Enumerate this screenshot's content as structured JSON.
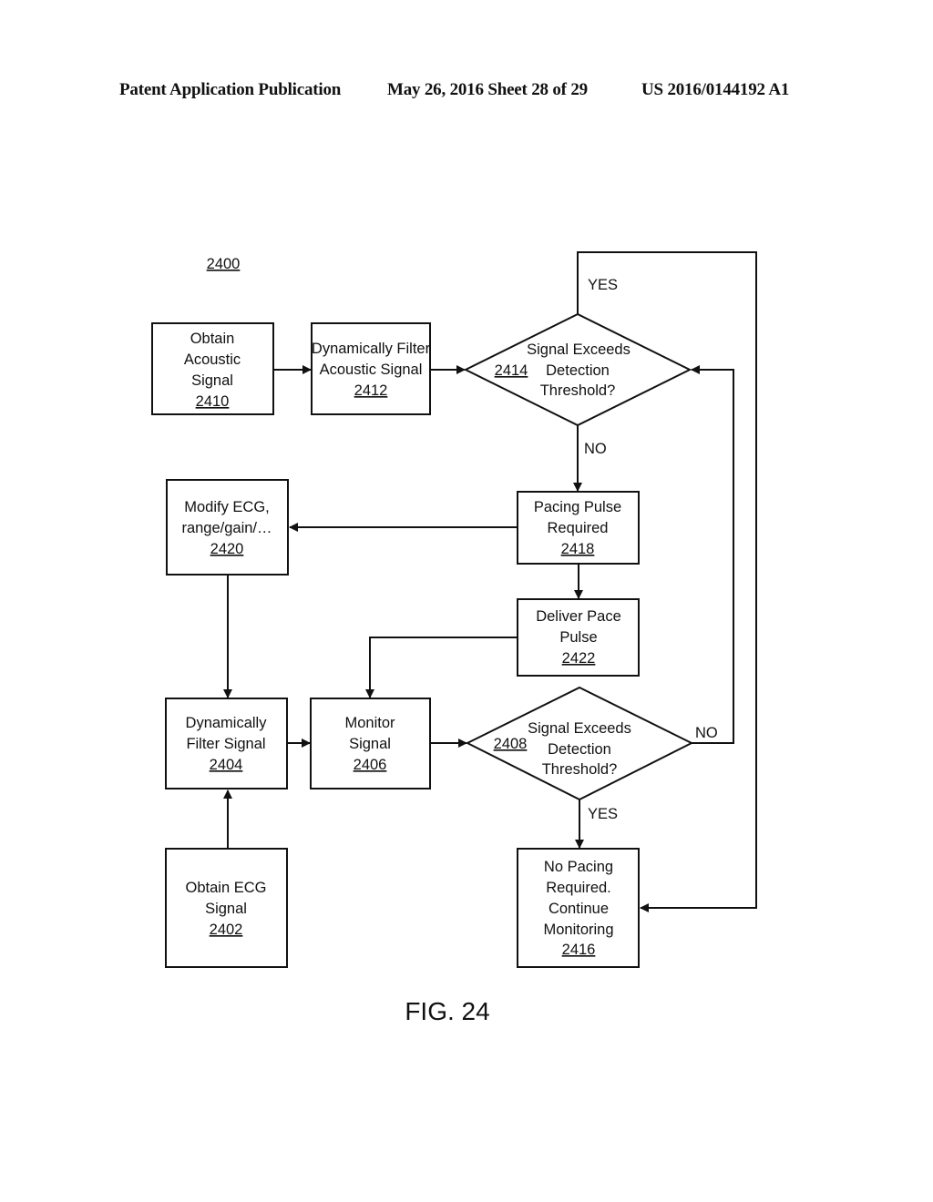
{
  "header": {
    "publication": "Patent Application Publication",
    "date_sheet": "May 26, 2016  Sheet 28 of 29",
    "number": "US 2016/0144192 A1"
  },
  "figure": {
    "ref": "2400",
    "caption": "FIG. 24",
    "nodes": {
      "n2410": {
        "lines": [
          "Obtain",
          "Acoustic",
          "Signal"
        ],
        "ref": "2410"
      },
      "n2412": {
        "lines": [
          "Dynamically Filter",
          "Acoustic Signal"
        ],
        "ref": "2412"
      },
      "n2414": {
        "lines": [
          "Signal Exceeds",
          "Detection",
          "Threshold?"
        ],
        "ref": "2414"
      },
      "n2418": {
        "lines": [
          "Pacing Pulse",
          "Required"
        ],
        "ref": "2418"
      },
      "n2420": {
        "lines": [
          "Modify ECG,",
          "range/gain/…"
        ],
        "ref": "2420"
      },
      "n2422": {
        "lines": [
          "Deliver Pace",
          "Pulse"
        ],
        "ref": "2422"
      },
      "n2404": {
        "lines": [
          "Dynamically",
          "Filter Signal"
        ],
        "ref": "2404"
      },
      "n2406": {
        "lines": [
          "Monitor",
          "Signal"
        ],
        "ref": "2406"
      },
      "n2408": {
        "lines": [
          "Signal Exceeds",
          "Detection",
          "Threshold?"
        ],
        "ref": "2408"
      },
      "n2402": {
        "lines": [
          "Obtain ECG",
          "Signal"
        ],
        "ref": "2402"
      },
      "n2416": {
        "lines": [
          "No Pacing",
          "Required.",
          "Continue",
          "Monitoring"
        ],
        "ref": "2416"
      }
    },
    "edge_labels": {
      "yes_2414": "YES",
      "no_2414": "NO",
      "no_2408": "NO",
      "yes_2408": "YES"
    }
  }
}
